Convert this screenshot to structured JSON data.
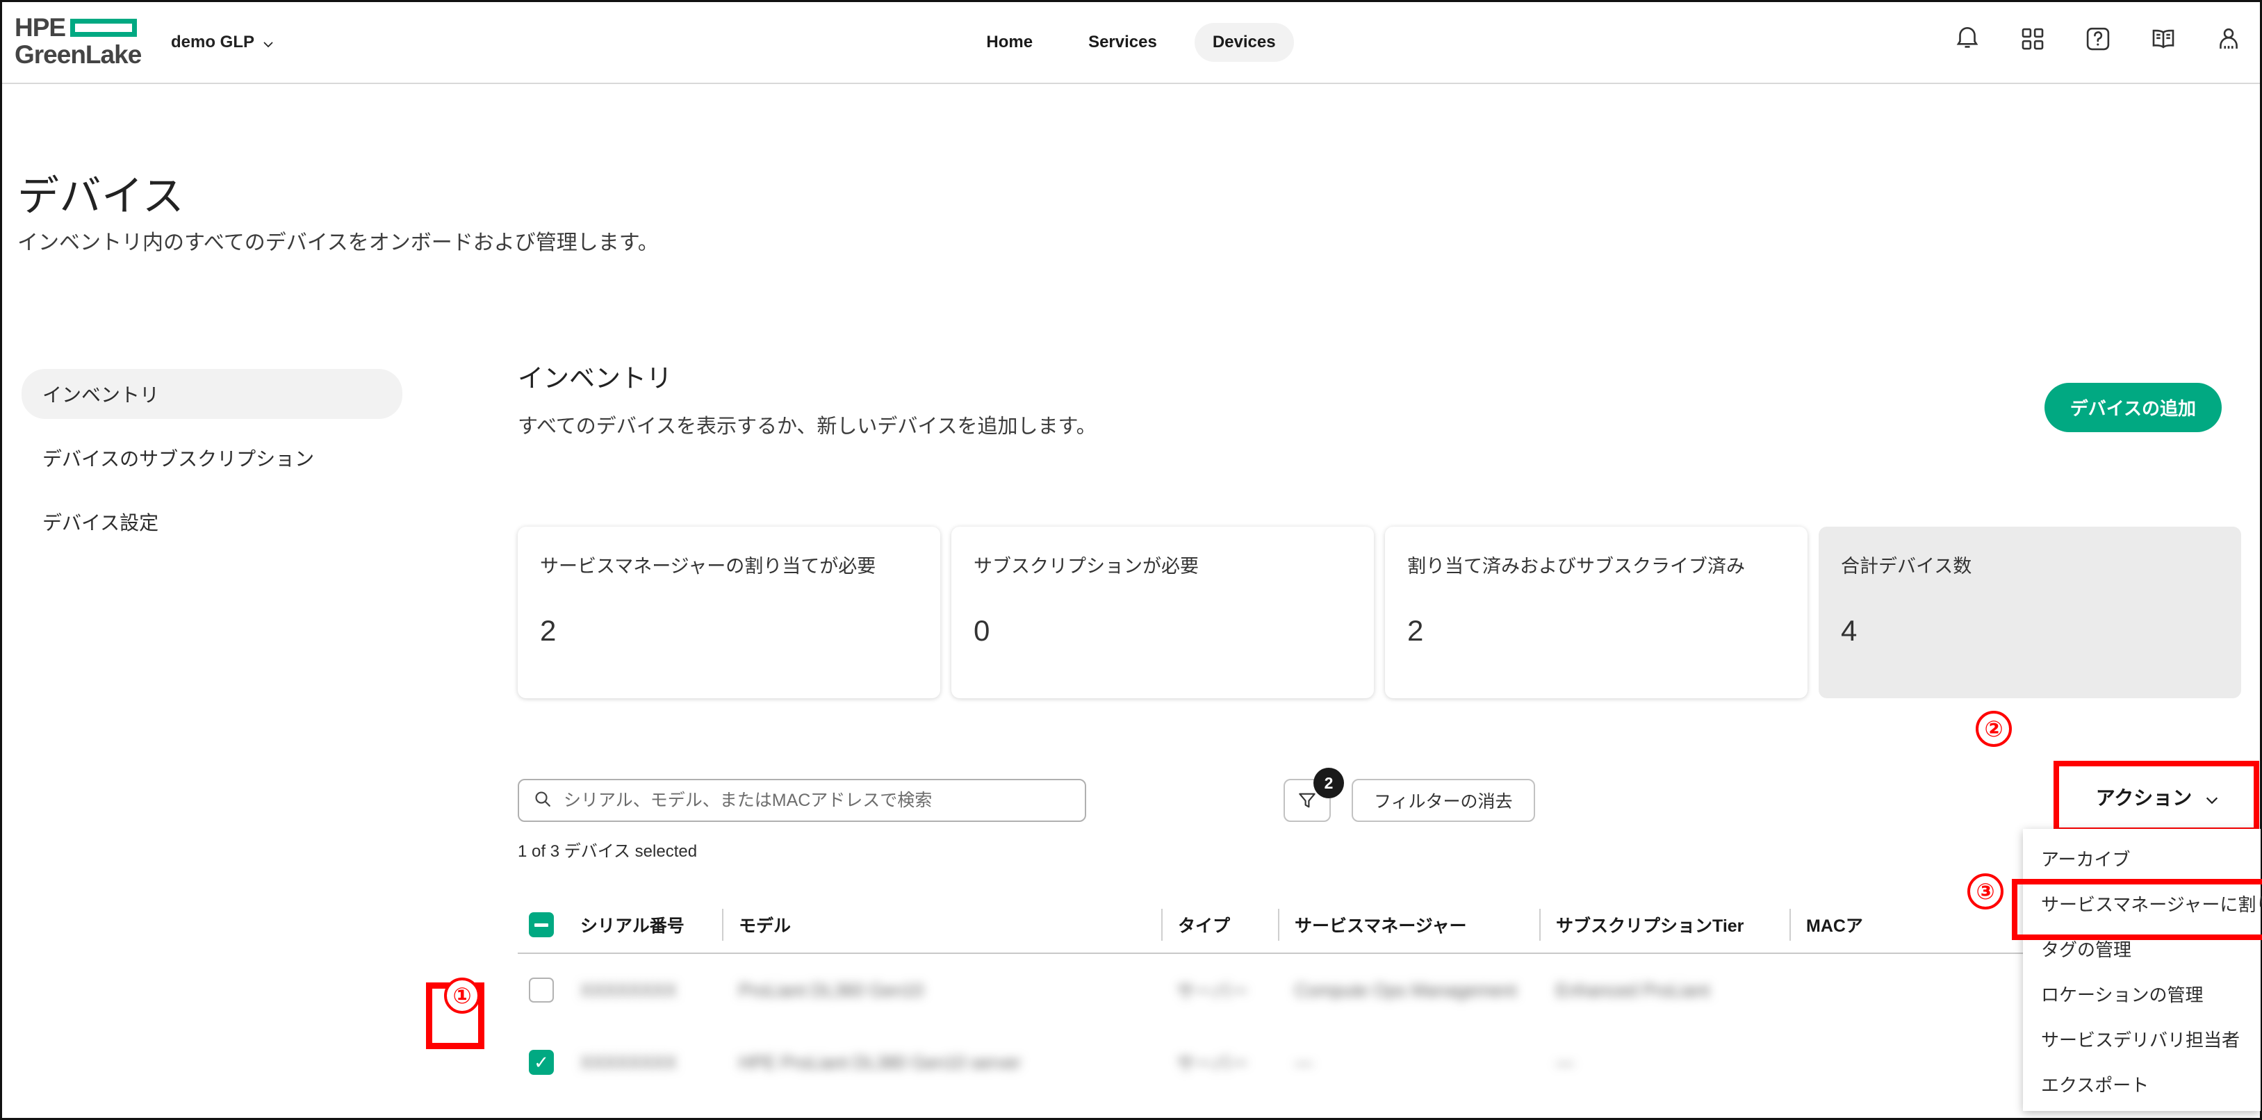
{
  "topbar": {
    "brand": {
      "hpe": "HPE",
      "greenlake": "GreenLake"
    },
    "org": "demo GLP",
    "nav": [
      {
        "label": "Home",
        "active": false
      },
      {
        "label": "Services",
        "active": false
      },
      {
        "label": "Devices",
        "active": true
      }
    ],
    "icons": [
      {
        "name": "bell-icon"
      },
      {
        "name": "apps-grid-icon"
      },
      {
        "name": "help-icon"
      },
      {
        "name": "docs-book-icon"
      },
      {
        "name": "user-profile-icon"
      }
    ]
  },
  "page": {
    "title": "デバイス",
    "subtitle": "インベントリ内のすべてのデバイスをオンボードおよび管理します。"
  },
  "sidebar": {
    "items": [
      {
        "label": "インベントリ",
        "active": true
      },
      {
        "label": "デバイスのサブスクリプション",
        "active": false
      },
      {
        "label": "デバイス設定",
        "active": false
      }
    ]
  },
  "main": {
    "section_title": "インベントリ",
    "section_subtitle": "すべてのデバイスを表示するか、新しいデバイスを追加します。",
    "add_device_label": "デバイスの追加"
  },
  "cards": [
    {
      "label": "サービスマネージャーの割り当てが必要",
      "value": "2",
      "muted": false
    },
    {
      "label": "サブスクリプションが必要",
      "value": "0",
      "muted": false
    },
    {
      "label": "割り当て済みおよびサブスクライブ済み",
      "value": "2",
      "muted": false
    },
    {
      "label": "合計デバイス数",
      "value": "4",
      "muted": true
    }
  ],
  "toolbar": {
    "search_placeholder": "シリアル、モデル、またはMACアドレスで検索",
    "search_value": "",
    "selected_status": "1 of 3 デバイス selected",
    "filter_badge": "2",
    "clear_filter_label": "フィルターの消去",
    "actions_label": "アクション"
  },
  "actions_menu": {
    "items": [
      {
        "label": "アーカイブ",
        "highlighted": false
      },
      {
        "label": "サービスマネージャーに割り当て",
        "highlighted": true
      },
      {
        "label": "タグの管理",
        "highlighted": false
      },
      {
        "label": "ロケーションの管理",
        "highlighted": false
      },
      {
        "label": "サービスデリバリ担当者",
        "highlighted": false
      },
      {
        "label": "エクスポート",
        "highlighted": false
      }
    ]
  },
  "table": {
    "header_checkbox_state": "indeterminate",
    "columns": [
      "シリアル番号",
      "モデル",
      "タイプ",
      "サービスマネージャー",
      "サブスクリプションTier",
      "MACア"
    ],
    "rows": [
      {
        "checked": false,
        "serial": "XXXXXXXX",
        "model": "ProLiant DL360 Gen10",
        "type": "サーバー",
        "service_manager": "Compute Ops Management",
        "tier": "Enhanced ProLiant",
        "mac": ""
      },
      {
        "checked": true,
        "serial": "XXXXXXXX",
        "model": "HPE ProLiant DL380 Gen10 server",
        "type": "サーバー",
        "service_manager": "—",
        "tier": "—",
        "mac": ""
      }
    ]
  },
  "annotations": [
    {
      "number": "①"
    },
    {
      "number": "②"
    },
    {
      "number": "③"
    }
  ],
  "colors": {
    "brand_green": "#01A982",
    "annotation_red": "#ff0000",
    "nav_active_bg": "#f2f2f2",
    "muted_card_bg": "#ebebeb"
  }
}
